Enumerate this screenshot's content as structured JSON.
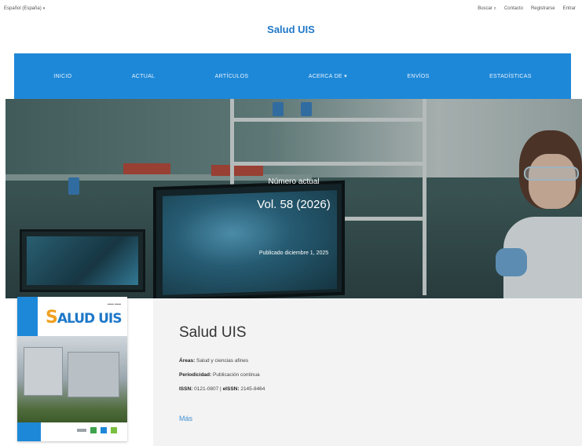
{
  "topbar": {
    "language": "Español (España)",
    "links": [
      "Buscar",
      "Contacto",
      "Registrarse",
      "Entrar"
    ]
  },
  "header": {
    "title": "Salud UIS"
  },
  "nav": {
    "items": [
      "INICIO",
      "ACTUAL",
      "ARTÍCULOS",
      "ACERCA DE",
      "ENVÍOS",
      "ESTADÍSTICAS"
    ]
  },
  "hero": {
    "kicker": "Número actual",
    "volume": "Vol. 58 (2026)",
    "published": "Publicado diciembre 1, 2025"
  },
  "journal": {
    "title": "Salud UIS",
    "areas_label": "Áreas:",
    "areas_value": "Salud y ciencias afines",
    "periodicity_label": "Periodicidad:",
    "periodicity_value": "Publicación continua",
    "issn_label": "ISSN:",
    "issn_value": "0121-0807",
    "eissn_label": "eISSN:",
    "eissn_value": "2145-8464",
    "more": "Más"
  },
  "cover": {
    "logo_text": "ALUD UIS",
    "logo_initial": "S"
  },
  "colors": {
    "brand_blue": "#1e88d8",
    "link_blue": "#3f8fd2",
    "title_blue": "#1e78c8"
  }
}
